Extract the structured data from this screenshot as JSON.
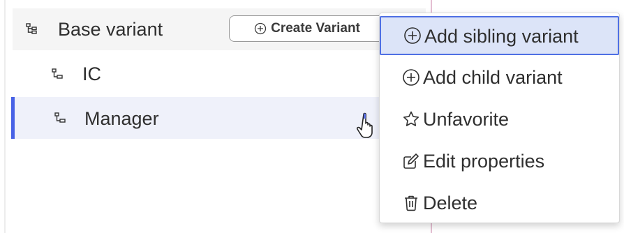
{
  "tree": {
    "base_variant": {
      "label": "Base variant",
      "icon": "tree-structure-icon"
    },
    "create_variant_button": {
      "label": "Create Variant",
      "icon": "plus-circle-icon"
    },
    "children": [
      {
        "label": "IC",
        "icon": "child-variant-icon",
        "selected": false
      },
      {
        "label": "Manager",
        "icon": "child-variant-icon",
        "selected": true
      }
    ],
    "selection_color": "#4862e6"
  },
  "context_menu": {
    "items": [
      {
        "label": "Add sibling variant",
        "icon": "plus-circle-icon",
        "hovered": true
      },
      {
        "label": "Add child variant",
        "icon": "plus-circle-icon",
        "hovered": false
      },
      {
        "label": "Unfavorite",
        "icon": "star-outline-icon",
        "hovered": false
      },
      {
        "label": "Edit properties",
        "icon": "edit-icon",
        "hovered": false
      },
      {
        "label": "Delete",
        "icon": "trash-icon",
        "hovered": false
      }
    ],
    "hover_color": "#dce4f8",
    "hover_border_color": "#4f70e4"
  },
  "cursor": {
    "icon": "hand-pointer-icon"
  }
}
